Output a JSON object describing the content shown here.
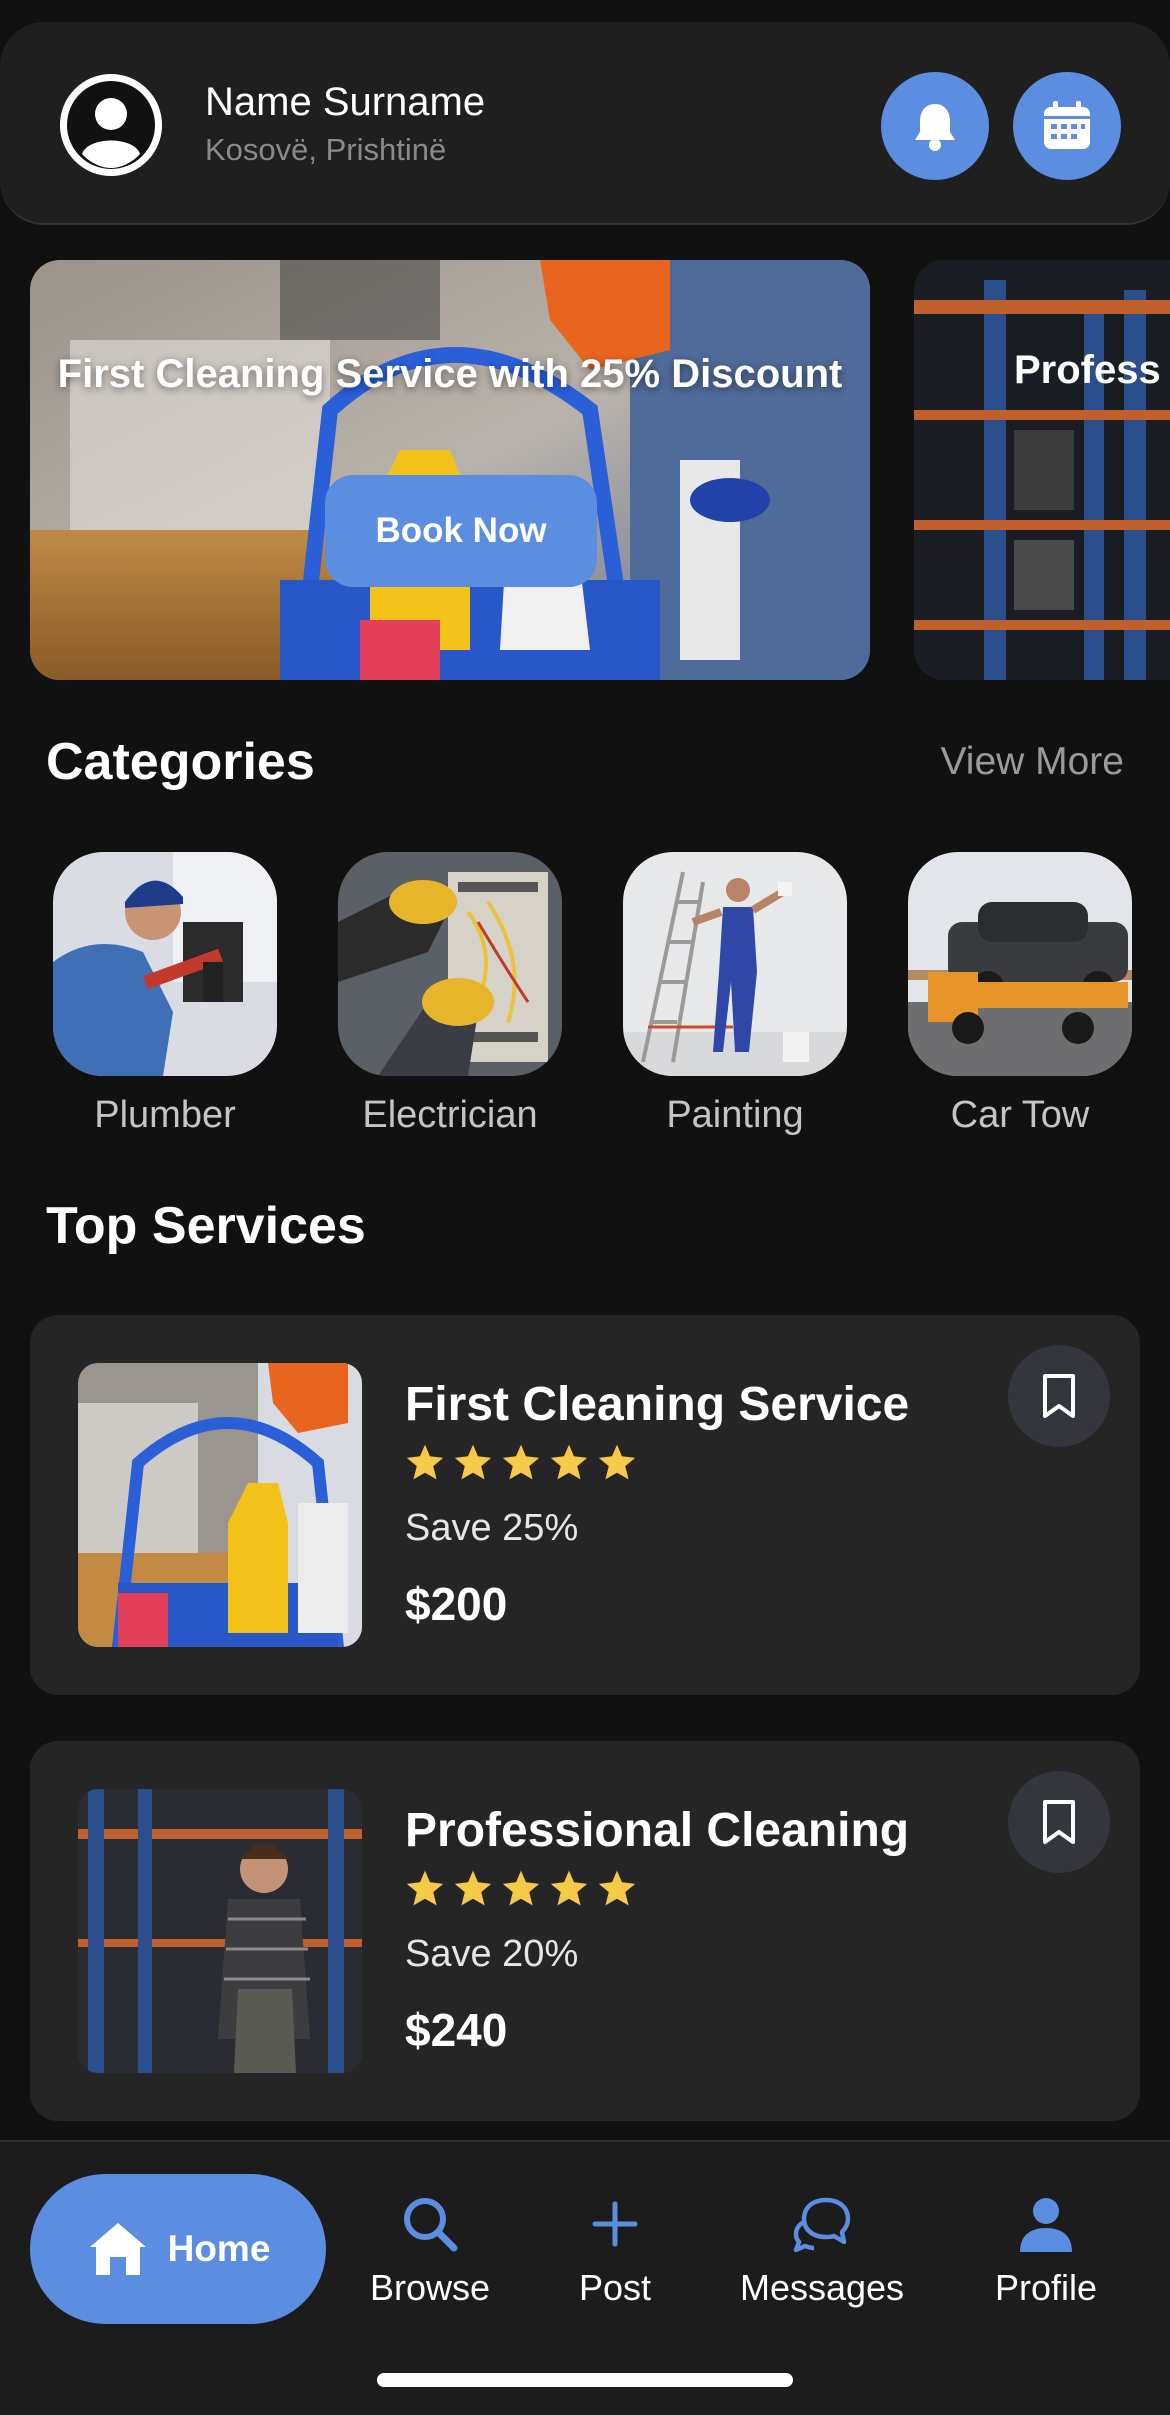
{
  "header": {
    "name": "Name Surname",
    "location": "Kosovë, Prishtinë",
    "icons": [
      "notification-bell-icon",
      "calendar-icon"
    ]
  },
  "banners": [
    {
      "title": "First Cleaning Service with 25% Discount",
      "button": "Book Now"
    },
    {
      "title": "Profess"
    }
  ],
  "categories": {
    "title": "Categories",
    "view_more": "View More",
    "items": [
      {
        "label": "Plumber"
      },
      {
        "label": "Electrician"
      },
      {
        "label": "Painting"
      },
      {
        "label": "Car Tow"
      }
    ]
  },
  "top_services": {
    "title": "Top Services",
    "items": [
      {
        "title": "First Cleaning Service",
        "rating": 5,
        "save": "Save 25%",
        "price": "$200"
      },
      {
        "title": "Professional Cleaning",
        "rating": 5,
        "save": "Save 20%",
        "price": "$240"
      }
    ]
  },
  "nav": {
    "home": "Home",
    "browse": "Browse",
    "post": "Post",
    "messages": "Messages",
    "profile": "Profile"
  },
  "colors": {
    "accent": "#5b8ee0",
    "background": "#111111",
    "card": "#252525",
    "star": "#f7c948"
  }
}
